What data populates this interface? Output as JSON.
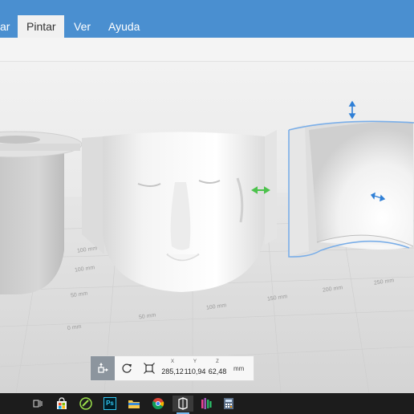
{
  "menu": {
    "items": [
      {
        "label": "ar"
      },
      {
        "label": "Pintar",
        "active": true
      },
      {
        "label": "Ver"
      },
      {
        "label": "Ayuda"
      }
    ]
  },
  "viewport": {
    "axis_labels": [
      "100 mm",
      "100 mm",
      "50 mm",
      "0 mm",
      "50 mm",
      "100 mm",
      "150 mm",
      "200 mm",
      "250 mm"
    ],
    "selection_color": "#7aaee8",
    "handle_color": "#2f7fd6",
    "move_handle_color": "#4cc24c"
  },
  "transform": {
    "tools": [
      "move-tool-icon",
      "rotate-icon",
      "scale-icon"
    ],
    "x_label": "X",
    "x_value": "285,12",
    "y_label": "Y",
    "y_value": "110,94",
    "z_label": "Z",
    "z_value": "62,48",
    "unit": "mm"
  },
  "taskbar": {
    "icons": [
      "task-view-icon",
      "store-icon",
      "app-green-icon",
      "photoshop-icon",
      "file-explorer-icon",
      "chrome-icon",
      "3d-builder-icon",
      "media-app-icon",
      "calculator-icon"
    ],
    "photoshop_text": "Ps"
  }
}
